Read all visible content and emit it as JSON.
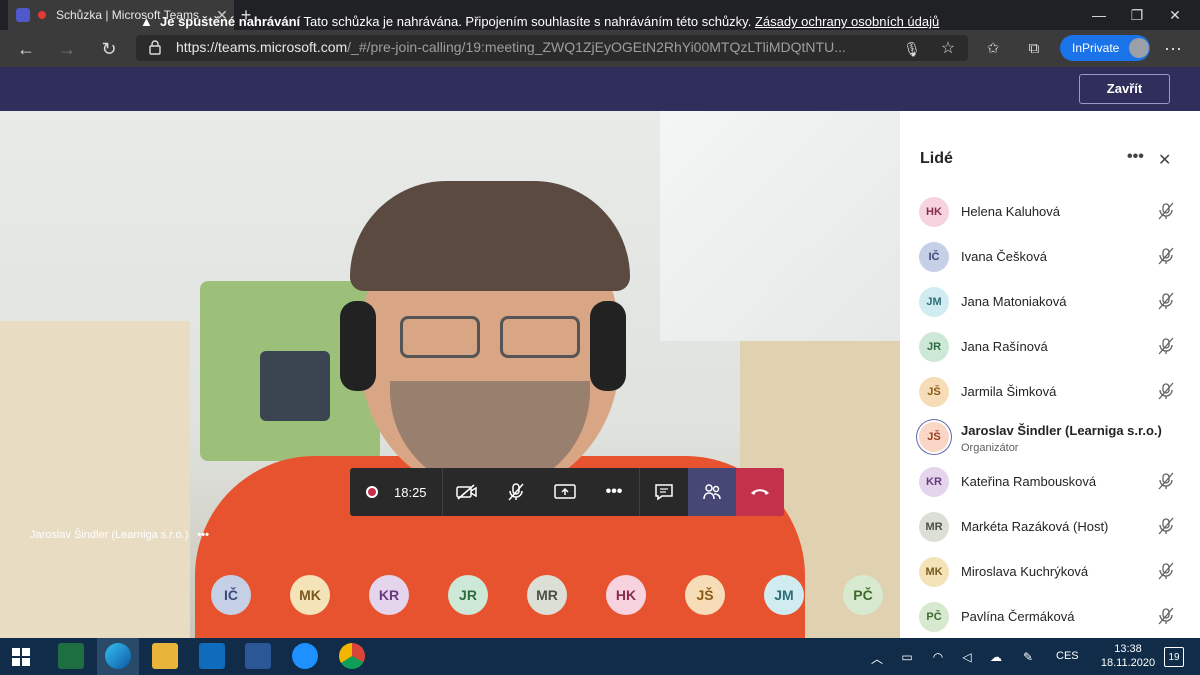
{
  "browser": {
    "tab_title": "Schůzka | Microsoft Teams",
    "url_host": "https://teams.microsoft.com",
    "url_path": "/_#/pre-join-calling/19:meeting_ZWQ1ZjEyOGEtN2RhYi00MTQzLTliMDQtNTU...",
    "inprivate_label": "InPrivate"
  },
  "banner": {
    "bold": "Je spuštěné nahrávání",
    "text": " Tato schůzka je nahrávána. Připojením souhlasíte s nahráváním této schůzky. ",
    "link": "Zásady ochrany osobních údajů",
    "close_label": "Zavřít"
  },
  "video": {
    "speaker_name": "Jaroslav Šindler (Learniga s.r.o.)",
    "more_label": "•••"
  },
  "controls": {
    "timer": "18:25",
    "more_label": "•••"
  },
  "bubbles": [
    {
      "initials": "IČ",
      "bg": "#c5d0e6",
      "fg": "#394a7a"
    },
    {
      "initials": "MK",
      "bg": "#f4e2b9",
      "fg": "#7a5a1c"
    },
    {
      "initials": "KR",
      "bg": "#e4d4ec",
      "fg": "#6b3a7e"
    },
    {
      "initials": "JR",
      "bg": "#cde8d6",
      "fg": "#2f6b3f"
    },
    {
      "initials": "MR",
      "bg": "#dcdfd6",
      "fg": "#4b5043"
    },
    {
      "initials": "HK",
      "bg": "#f6d3df",
      "fg": "#8a2d4c"
    },
    {
      "initials": "JŠ",
      "bg": "#f7ddb7",
      "fg": "#8a5a16"
    },
    {
      "initials": "JM",
      "bg": "#d1ecf0",
      "fg": "#2e6e78"
    },
    {
      "initials": "PČ",
      "bg": "#d7e9cf",
      "fg": "#3d6a2e"
    }
  ],
  "people": {
    "title": "Lidé",
    "more_label": "•••",
    "close_label": "✕",
    "list": [
      {
        "initials": "HK",
        "name": "Helena Kaluhová",
        "bg": "#f6d3df",
        "fg": "#8a2d4c",
        "muted": true
      },
      {
        "initials": "IČ",
        "name": "Ivana Češková",
        "bg": "#c5d0e6",
        "fg": "#394a7a",
        "muted": true
      },
      {
        "initials": "JM",
        "name": "Jana Matoniaková",
        "bg": "#d1ecf0",
        "fg": "#2e6e78",
        "muted": true
      },
      {
        "initials": "JR",
        "name": "Jana Rašínová",
        "bg": "#cde8d6",
        "fg": "#2f6b3f",
        "muted": true
      },
      {
        "initials": "JŠ",
        "name": "Jarmila Šimková",
        "bg": "#f7ddb7",
        "fg": "#8a5a16",
        "muted": true
      },
      {
        "initials": "JŠ",
        "name": "Jaroslav Šindler (Learniga s.r.o.)",
        "role": "Organizátor",
        "bg": "#f9d6c6",
        "fg": "#9a3e1c",
        "muted": false
      },
      {
        "initials": "KR",
        "name": "Kateřina Rambousková",
        "bg": "#e4d4ec",
        "fg": "#6b3a7e",
        "muted": true
      },
      {
        "initials": "MR",
        "name": "Markéta Razáková (Host)",
        "bg": "#dcdfd6",
        "fg": "#4b5043",
        "muted": true
      },
      {
        "initials": "MK",
        "name": "Miroslava Kuchrýková",
        "bg": "#f4e2b9",
        "fg": "#7a5a1c",
        "muted": true
      },
      {
        "initials": "PČ",
        "name": "Pavlína Čermáková",
        "bg": "#d7e9cf",
        "fg": "#3d6a2e",
        "muted": true
      }
    ]
  },
  "taskbar": {
    "lang": "CES",
    "time": "13:38",
    "date": "18.11.2020",
    "notif_count": "19"
  }
}
